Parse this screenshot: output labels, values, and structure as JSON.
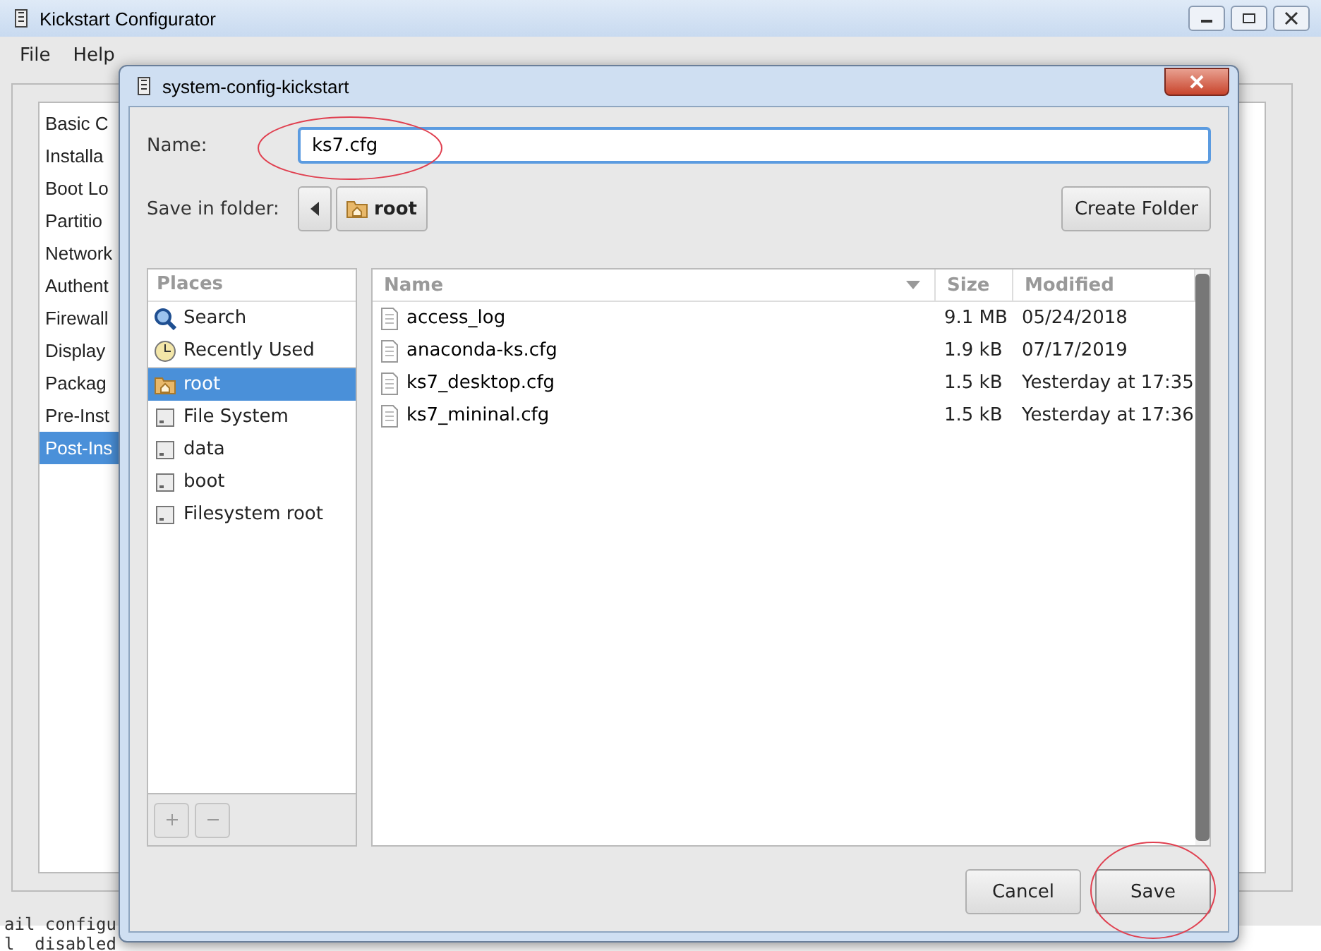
{
  "main_window": {
    "title": "Kickstart Configurator",
    "menu": [
      "File",
      "Help"
    ],
    "sidebar": [
      {
        "label": "Basic C",
        "selected": false
      },
      {
        "label": "Installa",
        "selected": false
      },
      {
        "label": "Boot Lo",
        "selected": false
      },
      {
        "label": "Partitio",
        "selected": false
      },
      {
        "label": "Network",
        "selected": false
      },
      {
        "label": "Authent",
        "selected": false
      },
      {
        "label": "Firewall",
        "selected": false
      },
      {
        "label": "Display",
        "selected": false
      },
      {
        "label": "Packag",
        "selected": false
      },
      {
        "label": "Pre-Inst",
        "selected": false
      },
      {
        "label": "Post-Ins",
        "selected": true
      }
    ]
  },
  "background_text": [
    "ail configu",
    "l  disabled"
  ],
  "dialog": {
    "title": "system-config-kickstart",
    "name_label": "Name:",
    "name_value": "ks7.cfg",
    "folder_label": "Save in folder:",
    "folder_path": "root",
    "create_folder": "Create Folder",
    "places": {
      "heading": "Places",
      "items": [
        {
          "label": "Search",
          "kind": "search",
          "selected": false
        },
        {
          "label": "Recently Used",
          "kind": "recent",
          "selected": false
        },
        {
          "label": "root",
          "kind": "home",
          "selected": true
        },
        {
          "label": "File System",
          "kind": "drive",
          "selected": false
        },
        {
          "label": "data",
          "kind": "drive",
          "selected": false
        },
        {
          "label": "boot",
          "kind": "drive",
          "selected": false
        },
        {
          "label": "Filesystem root",
          "kind": "drive",
          "selected": false
        }
      ]
    },
    "files": {
      "columns": [
        "Name",
        "Size",
        "Modified"
      ],
      "rows": [
        {
          "name": "access_log",
          "size": "9.1 MB",
          "modified": "05/24/2018"
        },
        {
          "name": "anaconda-ks.cfg",
          "size": "1.9 kB",
          "modified": "07/17/2019"
        },
        {
          "name": "ks7_desktop.cfg",
          "size": "1.5 kB",
          "modified": "Yesterday at 17:35"
        },
        {
          "name": "ks7_mininal.cfg",
          "size": "1.5 kB",
          "modified": "Yesterday at 17:36"
        }
      ]
    },
    "buttons": [
      {
        "label": "Cancel",
        "kind": "cancel"
      },
      {
        "label": "Save",
        "kind": "save"
      }
    ]
  }
}
